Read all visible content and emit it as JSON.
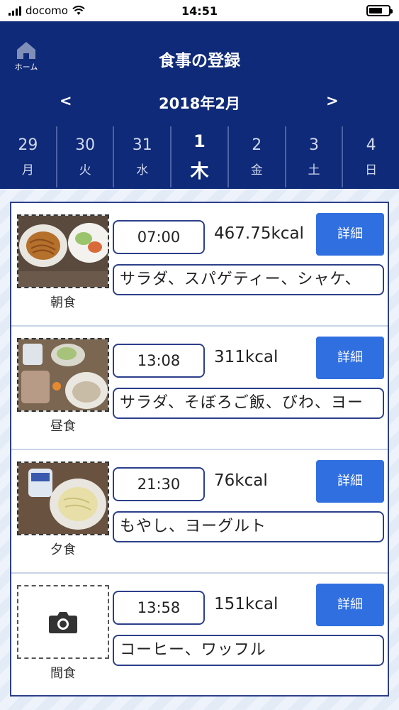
{
  "status_bar": {
    "carrier": "docomo",
    "time": "14:51"
  },
  "header": {
    "home_label": "ホーム",
    "title": "食事の登録",
    "month": "2018年2月",
    "prev": "<",
    "next": ">"
  },
  "days": [
    {
      "num": "29",
      "weekday": "月"
    },
    {
      "num": "30",
      "weekday": "火"
    },
    {
      "num": "31",
      "weekday": "水"
    },
    {
      "num": "1",
      "weekday": "木"
    },
    {
      "num": "2",
      "weekday": "金"
    },
    {
      "num": "3",
      "weekday": "土"
    },
    {
      "num": "4",
      "weekday": "日"
    }
  ],
  "meals": [
    {
      "label": "朝食",
      "time": "07:00",
      "kcal": "467.75kcal",
      "detail": "詳細",
      "foods": "サラダ、スパゲティー、シャケ、"
    },
    {
      "label": "昼食",
      "time": "13:08",
      "kcal": "311kcal",
      "detail": "詳細",
      "foods": "サラダ、そぼろご飯、びわ、ヨー"
    },
    {
      "label": "夕食",
      "time": "21:30",
      "kcal": "76kcal",
      "detail": "詳細",
      "foods": "もやし、ヨーグルト"
    },
    {
      "label": "間食",
      "time": "13:58",
      "kcal": "151kcal",
      "detail": "詳細",
      "foods": "コーヒー、ワッフル"
    }
  ],
  "icons": {
    "home": "home-icon",
    "camera": "camera-icon"
  },
  "colors": {
    "header_bg": "#0f2a78",
    "accent": "#2f6fe0",
    "border": "#2c3f8a"
  }
}
